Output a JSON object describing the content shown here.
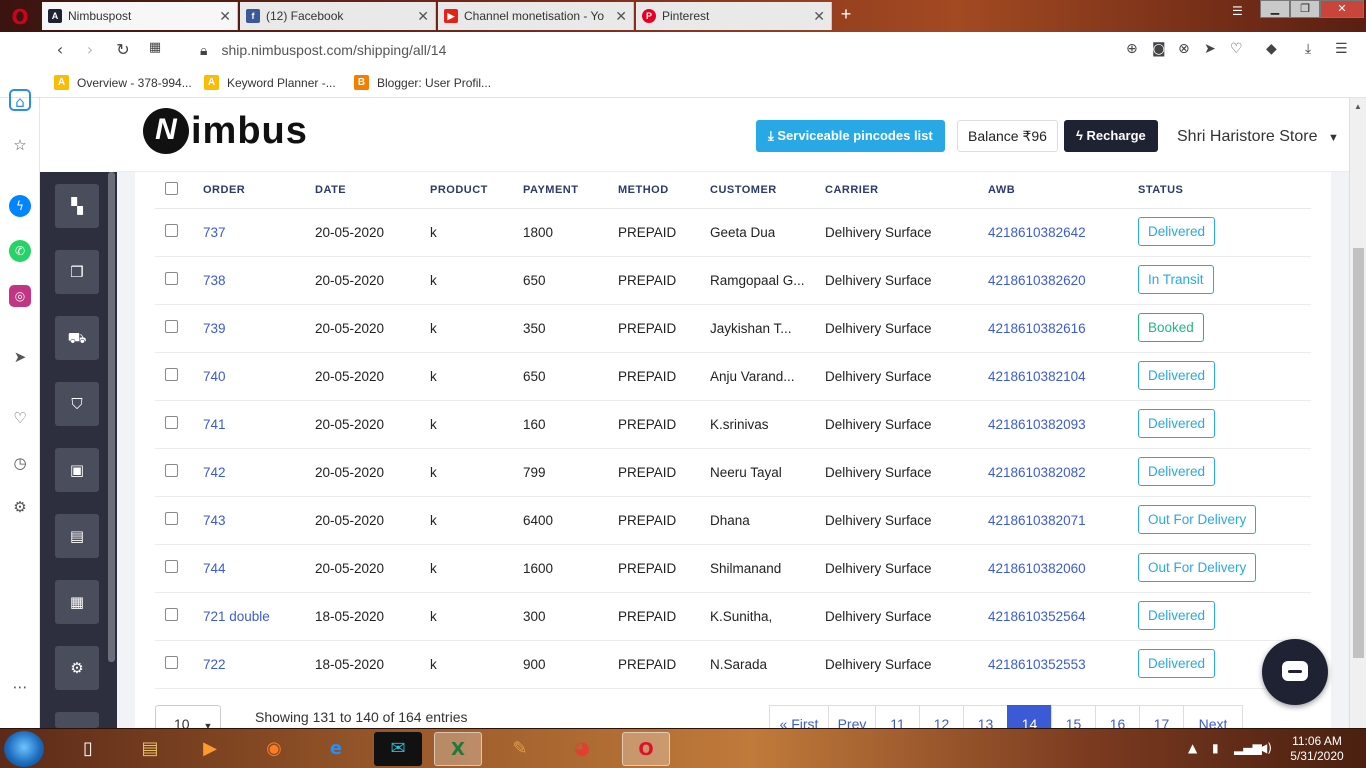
{
  "browser": {
    "tabs": [
      {
        "title": "Nimbuspost",
        "favicon": "A",
        "favicon_color": "#1f2233",
        "active": true
      },
      {
        "title": "(12) Facebook",
        "favicon": "f",
        "favicon_color": "#3b5998",
        "active": false
      },
      {
        "title": "Channel monetisation - Yo",
        "favicon": "▶",
        "favicon_color": "#e62117",
        "active": false
      },
      {
        "title": "Pinterest",
        "favicon": "P",
        "favicon_color": "#e60023",
        "active": false
      }
    ],
    "url": "ship.nimbuspost.com/shipping/all/14",
    "bookmarks": [
      {
        "label": "Overview - 378-994...",
        "icon": "A",
        "color": "#fbbc04"
      },
      {
        "label": "Keyword Planner -...",
        "icon": "A",
        "color": "#fbbc04"
      },
      {
        "label": "Blogger: User Profil...",
        "icon": "B",
        "color": "#f57d00"
      }
    ]
  },
  "header": {
    "logo_text": "imbus",
    "logo_mark": "N",
    "pincode_button": "Serviceable pincodes list",
    "balance": "Balance ₹96",
    "recharge_button": "Recharge",
    "store_name": "Shri Haristore Store"
  },
  "table": {
    "columns": [
      "ORDER",
      "DATE",
      "PRODUCT",
      "PAYMENT",
      "METHOD",
      "CUSTOMER",
      "CARRIER",
      "AWB",
      "STATUS"
    ],
    "rows": [
      {
        "order": "737",
        "date": "20-05-2020",
        "product": "k",
        "payment": "1800",
        "method": "PREPAID",
        "customer": "Geeta Dua",
        "carrier": "Delhivery Surface",
        "awb": "4218610382642",
        "status": "Delivered"
      },
      {
        "order": "738",
        "date": "20-05-2020",
        "product": "k",
        "payment": "650",
        "method": "PREPAID",
        "customer": "Ramgopaal G...",
        "carrier": "Delhivery Surface",
        "awb": "4218610382620",
        "status": "In Transit"
      },
      {
        "order": "739",
        "date": "20-05-2020",
        "product": "k",
        "payment": "350",
        "method": "PREPAID",
        "customer": "Jaykishan T...",
        "carrier": "Delhivery Surface",
        "awb": "4218610382616",
        "status": "Booked"
      },
      {
        "order": "740",
        "date": "20-05-2020",
        "product": "k",
        "payment": "650",
        "method": "PREPAID",
        "customer": "Anju Varand...",
        "carrier": "Delhivery Surface",
        "awb": "4218610382104",
        "status": "Delivered"
      },
      {
        "order": "741",
        "date": "20-05-2020",
        "product": "k",
        "payment": "160",
        "method": "PREPAID",
        "customer": "K.srinivas",
        "carrier": "Delhivery Surface",
        "awb": "4218610382093",
        "status": "Delivered"
      },
      {
        "order": "742",
        "date": "20-05-2020",
        "product": "k",
        "payment": "799",
        "method": "PREPAID",
        "customer": "Neeru Tayal",
        "carrier": "Delhivery Surface",
        "awb": "4218610382082",
        "status": "Delivered"
      },
      {
        "order": "743",
        "date": "20-05-2020",
        "product": "k",
        "payment": "6400",
        "method": "PREPAID",
        "customer": "Dhana",
        "carrier": "Delhivery Surface",
        "awb": "4218610382071",
        "status": "Out For Delivery"
      },
      {
        "order": "744",
        "date": "20-05-2020",
        "product": "k",
        "payment": "1600",
        "method": "PREPAID",
        "customer": "Shilmanand",
        "carrier": "Delhivery Surface",
        "awb": "4218610382060",
        "status": "Out For Delivery"
      },
      {
        "order": "721 double",
        "date": "18-05-2020",
        "product": "k",
        "payment": "300",
        "method": "PREPAID",
        "customer": "K.Sunitha,",
        "carrier": "Delhivery Surface",
        "awb": "4218610352564",
        "status": "Delivered"
      },
      {
        "order": "722",
        "date": "18-05-2020",
        "product": "k",
        "payment": "900",
        "method": "PREPAID",
        "customer": "N.Sarada",
        "carrier": "Delhivery Surface",
        "awb": "4218610352553",
        "status": "Delivered"
      }
    ]
  },
  "pagination": {
    "page_size": "10",
    "entries_text": "Showing 131 to 140 of 164 entries",
    "pages": [
      "« First",
      "Prev",
      "11",
      "12",
      "13",
      "14",
      "15",
      "16",
      "17",
      "Next"
    ],
    "active_page": "14"
  },
  "taskbar": {
    "time": "11:06 AM",
    "date": "5/31/2020"
  },
  "colors": {
    "accent": "#3b5bd6",
    "info": "#28a9e6",
    "success": "#1fb980",
    "sidebar": "#2d2f3e"
  }
}
